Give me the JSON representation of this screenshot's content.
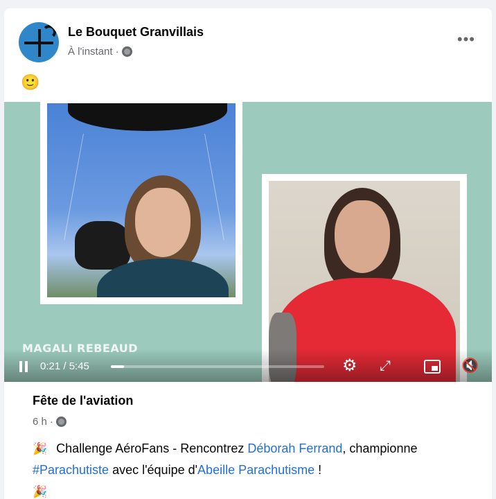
{
  "post": {
    "page_name": "Le Bouquet Granvillais",
    "timestamp": "À l'instant",
    "separator": " · ",
    "more_label": "•••",
    "emoji": "🙂"
  },
  "video": {
    "overlay_name": "MAGALI REBEAUD",
    "time_display": "0:21 / 5:45",
    "progress": 0.061,
    "icons": {
      "pause": "pause-icon",
      "settings": "gear-icon",
      "fullscreen": "expand-icon",
      "pip": "picture-in-picture-icon",
      "mute": "mute-icon"
    }
  },
  "shared": {
    "group_name": "Fête de l'aviation",
    "time": "6 h",
    "separator": " · ",
    "party_emoji": "🎉",
    "text_part1": " Challenge AéroFans - Rencontrez ",
    "link_person": "Déborah Ferrand",
    "text_part2": ", championne ",
    "hashtag": "#Parachutiste",
    "text_part3": " avec l'équipe d'",
    "link_team": "Abeille Parachutisme",
    "text_part4": " !"
  },
  "colors": {
    "link": "#216fdb",
    "video_bg": "#9ccbbd"
  }
}
